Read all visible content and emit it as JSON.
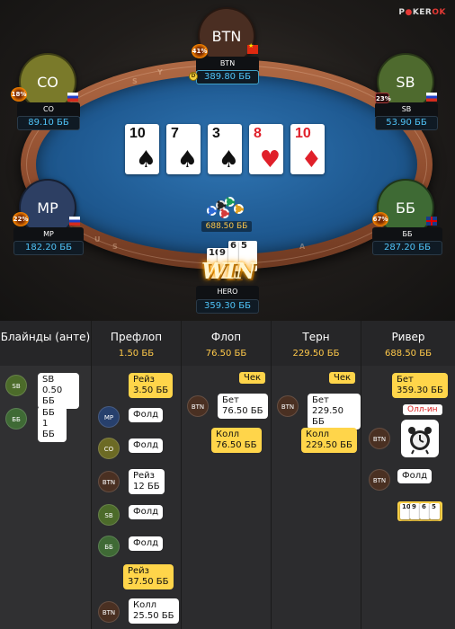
{
  "brand": {
    "logo_prefix": "P",
    "logo_mid": "KER",
    "logo_suffix": "OK"
  },
  "rail_text": [
    "S",
    "Y",
    "U",
    "S",
    "A"
  ],
  "players": {
    "btn": {
      "avatar": "BTN",
      "name": "BTN",
      "stack": "389.80 ББ",
      "equity": "41%",
      "flag": "CN",
      "color": "#4a2e22"
    },
    "co": {
      "avatar": "CO",
      "name": "CO",
      "stack": "89.10 ББ",
      "equity": "18%",
      "flag": "RU",
      "color": "#7a7a2a"
    },
    "sb": {
      "avatar": "SB",
      "name": "SB",
      "stack": "53.90 ББ",
      "equity": "23%",
      "flag": "RU",
      "color": "#4e6a2e"
    },
    "mp": {
      "avatar": "MP",
      "name": "MP",
      "stack": "182.20 ББ",
      "equity": "22%",
      "flag": "RU",
      "color": "#2d3f63"
    },
    "bb": {
      "avatar": "ББ",
      "name": "ББ",
      "stack": "287.20 ББ",
      "equity": "67%",
      "flag": "GB",
      "color": "#3e6a34"
    },
    "hero": {
      "name": "HERO",
      "stack": "359.30 ББ"
    }
  },
  "board": [
    {
      "rank": "10",
      "suit": "♠",
      "color": "black"
    },
    {
      "rank": "7",
      "suit": "♠",
      "color": "black"
    },
    {
      "rank": "3",
      "suit": "♠",
      "color": "black"
    },
    {
      "rank": "8",
      "suit": "♥",
      "color": "red"
    },
    {
      "rank": "10",
      "suit": "♦",
      "color": "red"
    }
  ],
  "pot": "688.50 ББ",
  "hero_cards": [
    "10",
    "9",
    "6",
    "5"
  ],
  "win_label": "WIN",
  "history": {
    "columns": [
      {
        "name": "Блайнды (анте)",
        "pot": ""
      },
      {
        "name": "Префлоп",
        "pot": "1.50 ББ"
      },
      {
        "name": "Флоп",
        "pot": "76.50 ББ"
      },
      {
        "name": "Терн",
        "pot": "229.50 ББ"
      },
      {
        "name": "Ривер",
        "pot": "688.50 ББ"
      }
    ],
    "blinds": [
      {
        "pos": "SB",
        "text1": "SB",
        "text2": "0.50 ББ"
      },
      {
        "pos": "ББ",
        "text1": "ББ",
        "text2": "1 ББ"
      }
    ],
    "preflop": [
      {
        "pos": "",
        "l1": "Рейз",
        "l2": "3.50 ББ"
      },
      {
        "pos": "MP",
        "l1": "Фолд",
        "l2": ""
      },
      {
        "pos": "CO",
        "l1": "Фолд",
        "l2": ""
      },
      {
        "pos": "BTN",
        "l1": "Рейз",
        "l2": "12 ББ"
      },
      {
        "pos": "SB",
        "l1": "Фолд",
        "l2": ""
      },
      {
        "pos": "ББ",
        "l1": "Фолд",
        "l2": ""
      },
      {
        "pos": "",
        "l1": "Рейз",
        "l2": "37.50 ББ"
      },
      {
        "pos": "BTN",
        "l1": "Колл",
        "l2": "25.50 ББ"
      }
    ],
    "flop": {
      "check": "Чек",
      "bet": {
        "pos": "BTN",
        "l1": "Бет",
        "l2": "76.50 ББ"
      },
      "call": {
        "l1": "Колл",
        "l2": "76.50 ББ"
      }
    },
    "turn": {
      "check": "Чек",
      "bet": {
        "pos": "BTN",
        "l1": "Бет",
        "l2": "229.50 ББ"
      },
      "call": {
        "l1": "Колл",
        "l2": "229.50 ББ"
      }
    },
    "river": {
      "bet": {
        "l1": "Бет",
        "l2": "359.30 ББ"
      },
      "allin": "Олл-ин",
      "btn_pos": "BTN",
      "fold": {
        "pos": "BTN",
        "l1": "Фолд"
      },
      "showdown_cards": [
        "10",
        "9",
        "6",
        "5"
      ]
    }
  }
}
